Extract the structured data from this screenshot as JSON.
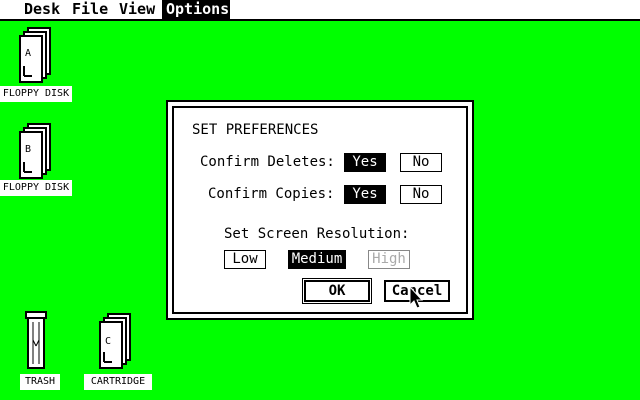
{
  "menubar": {
    "items": [
      {
        "label": "Desk"
      },
      {
        "label": "File"
      },
      {
        "label": "View"
      },
      {
        "label": "Options",
        "active": true
      }
    ]
  },
  "desktop": {
    "icons": [
      {
        "label": "FLOPPY DISK",
        "drive": "A",
        "icon": "floppy-disk-icon"
      },
      {
        "label": "FLOPPY DISK",
        "drive": "B",
        "icon": "floppy-disk-icon"
      },
      {
        "label": "TRASH",
        "icon": "trash-icon"
      },
      {
        "label": "CARTRIDGE",
        "drive": "C",
        "icon": "cartridge-icon"
      }
    ],
    "background_color": "#00ff00"
  },
  "dialog": {
    "title": "SET PREFERENCES",
    "confirm_deletes": {
      "label": "Confirm Deletes:",
      "yes": "Yes",
      "no": "No",
      "selected": "Yes"
    },
    "confirm_copies": {
      "label": "Confirm Copies:",
      "yes": "Yes",
      "no": "No",
      "selected": "Yes"
    },
    "resolution": {
      "label": "Set Screen Resolution:",
      "low": "Low",
      "medium": "Medium",
      "high": "High",
      "selected": "Medium",
      "disabled": "High"
    },
    "ok": "OK",
    "cancel": "Cancel"
  },
  "cursor": {
    "icon": "arrow-pointer-icon"
  }
}
